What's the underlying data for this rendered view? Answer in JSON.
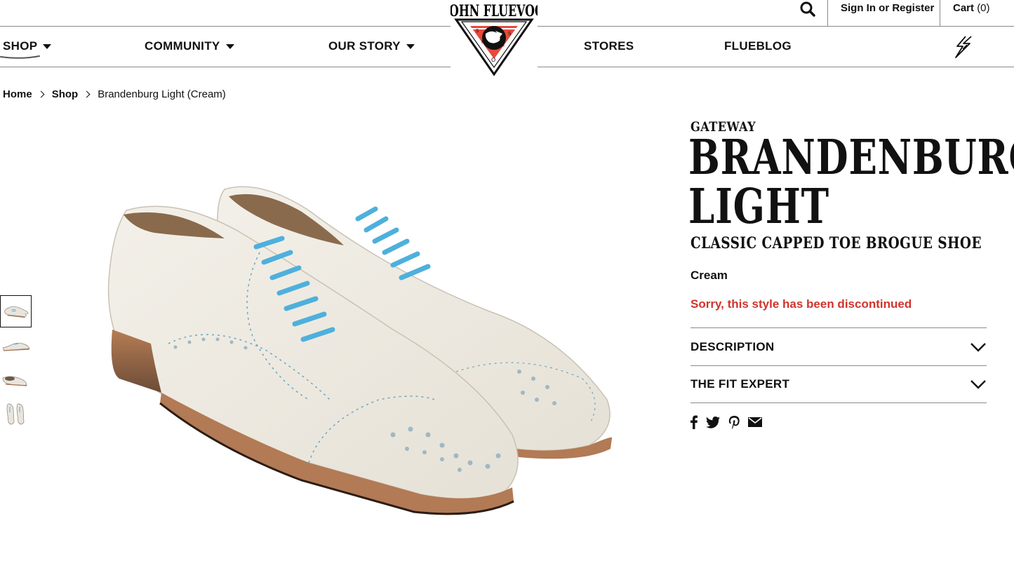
{
  "utility": {
    "sign_in_label": "Sign In or Register",
    "cart_label": "Cart",
    "cart_count": "(0)"
  },
  "nav": {
    "shop": "SHOP",
    "community": "COMMUNITY",
    "our_story": "OUR STORY",
    "stores": "STORES",
    "flueblog": "FLUEBLOG"
  },
  "logo": {
    "wordmark": "JOHN FLUEVOG",
    "tagline_letters": [
      "S",
      "H",
      "O",
      "E",
      "S"
    ]
  },
  "breadcrumb": {
    "home": "Home",
    "shop": "Shop",
    "current": "Brandenburg Light (Cream)"
  },
  "product": {
    "collection": "GATEWAY",
    "title_line1": "BRANDENBURG",
    "title_line2": "LIGHT",
    "subtitle": "CLASSIC CAPPED TOE BROGUE SHOE",
    "color": "Cream",
    "status": "Sorry, this style has been discontinued",
    "thumbnails_count": 4,
    "active_thumbnail": 1
  },
  "accordions": {
    "description": "DESCRIPTION",
    "fit_expert": "THE FIT EXPERT"
  },
  "share": [
    "facebook-icon",
    "twitter-icon",
    "pinterest-icon",
    "email-icon"
  ],
  "colors": {
    "text": "#111111",
    "alert": "#d0342c",
    "divider": "#8a8a8a",
    "leather": "#ece8df",
    "laces": "#4eb0dc",
    "sole": "#b27a55"
  }
}
